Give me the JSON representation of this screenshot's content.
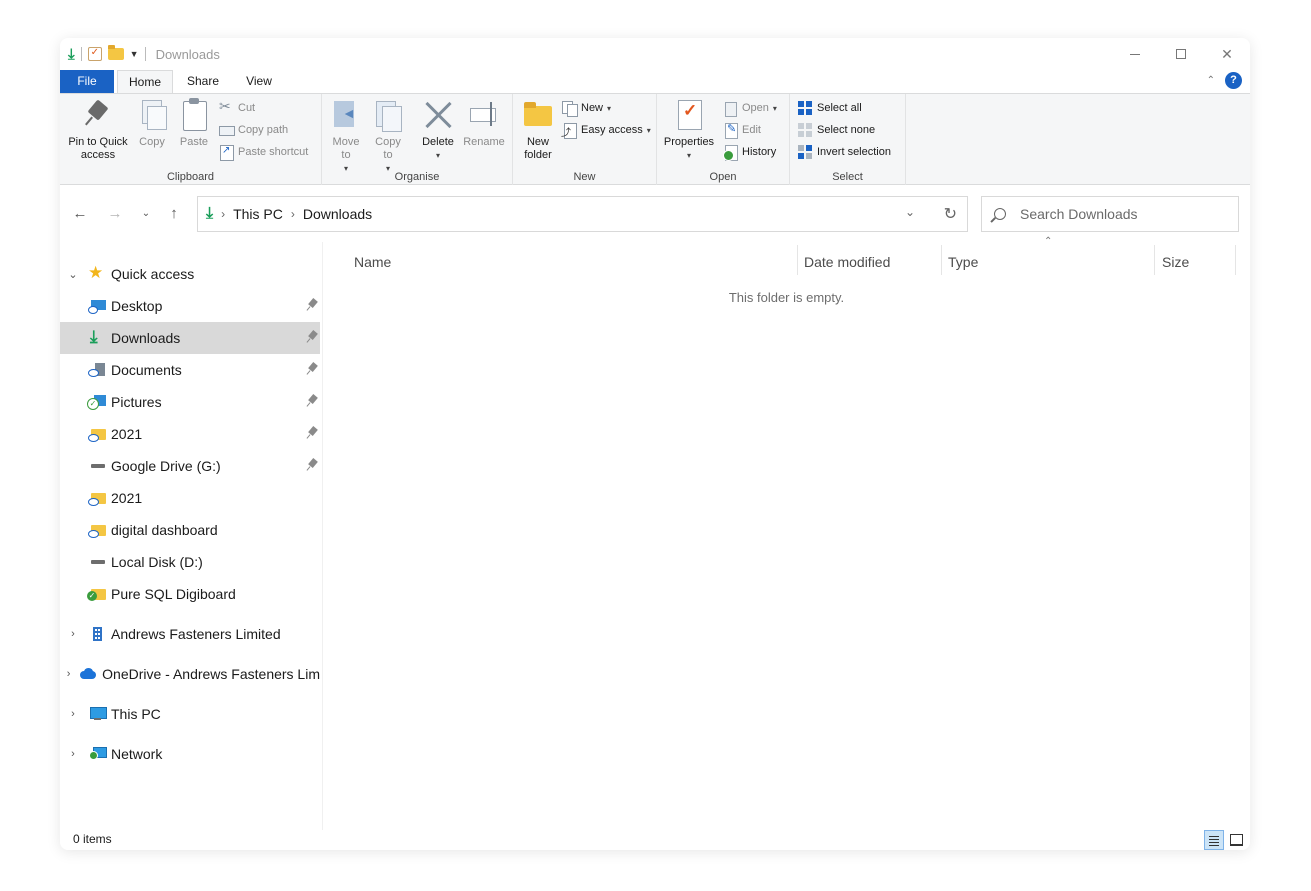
{
  "window": {
    "title": "Downloads",
    "controls": {
      "minimize": "─",
      "maximize": "☐",
      "close": "✕"
    }
  },
  "ribbon_tabs": [
    {
      "label": "File"
    },
    {
      "label": "Home"
    },
    {
      "label": "Share"
    },
    {
      "label": "View"
    }
  ],
  "ribbon": {
    "clipboard": {
      "label": "Clipboard",
      "pin": "Pin to Quick access",
      "copy": "Copy",
      "paste": "Paste",
      "cut": "Cut",
      "copy_path": "Copy path",
      "paste_shortcut": "Paste shortcut"
    },
    "organise": {
      "label": "Organise",
      "move_to": "Move to",
      "copy_to": "Copy to",
      "delete": "Delete",
      "rename": "Rename"
    },
    "new": {
      "label": "New",
      "new_folder": "New folder",
      "new_item": "New",
      "easy_access": "Easy access"
    },
    "open": {
      "label": "Open",
      "properties": "Properties",
      "open": "Open",
      "edit": "Edit",
      "history": "History"
    },
    "select": {
      "label": "Select",
      "select_all": "Select all",
      "select_none": "Select none",
      "invert_selection": "Invert selection"
    }
  },
  "address": {
    "path": [
      "This PC",
      "Downloads"
    ],
    "search_placeholder": "Search Downloads"
  },
  "nav_pane": {
    "quick_access": "Quick access",
    "pinned": [
      {
        "label": "Desktop",
        "icon": "desktop-icon",
        "pinned": true
      },
      {
        "label": "Downloads",
        "icon": "downloads-icon",
        "pinned": true,
        "selected": true
      },
      {
        "label": "Documents",
        "icon": "documents-icon",
        "pinned": true
      },
      {
        "label": "Pictures",
        "icon": "pictures-icon",
        "pinned": true
      },
      {
        "label": "2021",
        "icon": "folder-icon",
        "pinned": true
      },
      {
        "label": "Google Drive (G:)",
        "icon": "drive-icon",
        "pinned": true
      },
      {
        "label": "2021",
        "icon": "folder-icon",
        "pinned": false
      },
      {
        "label": "digital dashboard",
        "icon": "folder-icon",
        "pinned": false
      },
      {
        "label": "Local Disk (D:)",
        "icon": "drive-icon",
        "pinned": false
      },
      {
        "label": "Pure SQL Digiboard",
        "icon": "folder-icon",
        "pinned": false
      }
    ],
    "roots": [
      {
        "label": "Andrews Fasteners Limited",
        "icon": "building-icon"
      },
      {
        "label": "OneDrive - Andrews Fasteners Lim",
        "icon": "onedrive-icon"
      },
      {
        "label": "This PC",
        "icon": "pc-icon"
      },
      {
        "label": "Network",
        "icon": "network-icon"
      }
    ]
  },
  "content": {
    "columns": [
      "Name",
      "Date modified",
      "Type",
      "Size"
    ],
    "empty_message": "This folder is empty."
  },
  "status": {
    "item_count": "0 items"
  },
  "colors": {
    "accent": "#1a62c4",
    "file_tab": "#1a62c4",
    "ribbon_bg": "#f5f6f7",
    "selected_nav": "#d9d9d9"
  }
}
